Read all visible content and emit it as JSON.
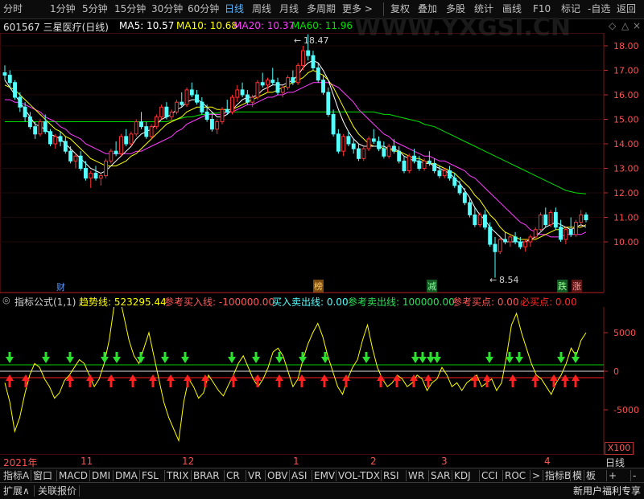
{
  "toolbar": {
    "periods": [
      "分时",
      "1分钟",
      "5分钟",
      "15分钟",
      "30分钟",
      "60分钟",
      "日线",
      "周线",
      "月线",
      "多周期",
      "更多 >"
    ],
    "active_period": "日线",
    "actions": [
      "复权",
      "叠加",
      "多股",
      "统计",
      "画线",
      "F10",
      "标记",
      "-自选",
      "返回"
    ]
  },
  "title": {
    "code_name": "601567 三星医疗(日线)",
    "ma5": "MA5: 10.57",
    "ma10": "MA10: 10.68",
    "ma20": "MA20: 10.37",
    "ma60": "MA60: 11.96",
    "watermark": "WWW.YXGSI.CN"
  },
  "colors": {
    "ma5": "#ffffff",
    "ma10": "#ffff00",
    "ma20": "#ff3cff",
    "ma60": "#00e000",
    "up": "#ff3232",
    "down": "#54ffff",
    "indicator": "#ffff00"
  },
  "price_axis": {
    "ticks": [
      "18.00",
      "17.00",
      "16.00",
      "15.00",
      "14.00",
      "13.00",
      "12.00",
      "11.00",
      "10.00"
    ],
    "ylim": [
      9.6,
      18.6
    ]
  },
  "annotations": {
    "high": "18.47",
    "low": "8.54",
    "markers": [
      {
        "label": "财",
        "color": "#5a9aff"
      },
      {
        "label": "榜",
        "color": "#e89a2c"
      },
      {
        "label": "减",
        "color": "#2cd05a"
      },
      {
        "label": "跌",
        "color": "#2cd05a"
      },
      {
        "label": "涨",
        "color": "#ff3c3c"
      }
    ]
  },
  "indicator": {
    "header_prefix": "指标公式(1,1)",
    "trend": "趋势线: 523295.44",
    "ref_buy_line": "参考买入线: -100000.00",
    "buy_sell_line": "买入卖出线: 0.00",
    "ref_sell_line": "参考卖出线: 100000.00",
    "ref_buy_point": "参考买点: 0.00",
    "must_buy": "必买点: 0.00",
    "ticks": [
      "5000",
      "0",
      "-5000"
    ],
    "scale_label": "X100"
  },
  "chart_data": {
    "type": "candlestick",
    "ylim": [
      9.6,
      18.6
    ],
    "candles": [
      [
        16.9,
        17.2,
        16.6,
        16.8
      ],
      [
        16.8,
        17.0,
        16.3,
        16.5
      ],
      [
        16.5,
        16.6,
        15.8,
        15.9
      ],
      [
        15.9,
        16.1,
        15.3,
        15.5
      ],
      [
        15.5,
        15.7,
        14.9,
        15.1
      ],
      [
        15.1,
        15.3,
        14.6,
        14.7
      ],
      [
        14.7,
        14.9,
        14.2,
        14.4
      ],
      [
        14.4,
        15.0,
        14.3,
        14.9
      ],
      [
        14.9,
        15.2,
        14.4,
        14.5
      ],
      [
        14.5,
        14.6,
        13.9,
        14.0
      ],
      [
        14.0,
        14.4,
        13.8,
        14.3
      ],
      [
        14.3,
        14.5,
        13.9,
        14.1
      ],
      [
        14.1,
        14.3,
        13.6,
        13.7
      ],
      [
        13.7,
        13.9,
        13.2,
        13.3
      ],
      [
        13.3,
        13.6,
        13.0,
        13.5
      ],
      [
        13.5,
        13.7,
        12.9,
        13.0
      ],
      [
        13.0,
        13.3,
        12.5,
        12.6
      ],
      [
        12.6,
        12.9,
        12.2,
        12.8
      ],
      [
        12.8,
        13.1,
        12.5,
        12.6
      ],
      [
        12.6,
        12.8,
        12.3,
        12.7
      ],
      [
        12.7,
        13.4,
        12.6,
        13.3
      ],
      [
        13.3,
        13.8,
        13.2,
        13.7
      ],
      [
        13.7,
        14.1,
        13.5,
        13.6
      ],
      [
        13.6,
        14.4,
        13.5,
        14.3
      ],
      [
        14.3,
        14.6,
        13.9,
        14.0
      ],
      [
        14.0,
        14.5,
        13.9,
        14.4
      ],
      [
        14.4,
        15.0,
        14.3,
        14.9
      ],
      [
        14.9,
        15.3,
        14.6,
        14.7
      ],
      [
        14.7,
        14.9,
        14.2,
        14.3
      ],
      [
        14.3,
        14.8,
        14.2,
        14.7
      ],
      [
        14.7,
        15.2,
        14.6,
        15.1
      ],
      [
        15.1,
        15.6,
        15.0,
        15.5
      ],
      [
        15.5,
        15.7,
        15.0,
        15.1
      ],
      [
        15.1,
        15.4,
        14.9,
        15.3
      ],
      [
        15.3,
        15.8,
        15.2,
        15.7
      ],
      [
        15.7,
        16.1,
        15.5,
        15.6
      ],
      [
        15.6,
        16.3,
        15.5,
        16.2
      ],
      [
        16.2,
        16.5,
        15.9,
        16.0
      ],
      [
        16.0,
        16.2,
        15.6,
        15.7
      ],
      [
        15.7,
        15.9,
        15.2,
        15.3
      ],
      [
        15.3,
        15.6,
        14.9,
        15.0
      ],
      [
        15.0,
        15.3,
        14.5,
        14.6
      ],
      [
        14.6,
        15.0,
        14.4,
        14.9
      ],
      [
        14.9,
        15.5,
        14.8,
        15.4
      ],
      [
        15.4,
        15.8,
        15.2,
        15.3
      ],
      [
        15.3,
        16.0,
        15.2,
        15.9
      ],
      [
        15.9,
        16.4,
        15.7,
        16.2
      ],
      [
        16.2,
        16.5,
        15.9,
        16.0
      ],
      [
        16.0,
        16.2,
        15.6,
        15.7
      ],
      [
        15.7,
        16.0,
        15.5,
        15.9
      ],
      [
        15.9,
        16.6,
        15.8,
        16.5
      ],
      [
        16.5,
        16.9,
        16.3,
        16.4
      ],
      [
        16.4,
        16.7,
        16.1,
        16.6
      ],
      [
        16.6,
        17.1,
        16.4,
        16.5
      ],
      [
        16.5,
        16.7,
        16.0,
        16.1
      ],
      [
        16.1,
        16.4,
        15.9,
        16.3
      ],
      [
        16.3,
        16.8,
        16.2,
        16.7
      ],
      [
        16.7,
        17.0,
        16.4,
        16.5
      ],
      [
        16.5,
        17.3,
        16.4,
        17.2
      ],
      [
        17.2,
        18.0,
        17.0,
        17.8
      ],
      [
        17.8,
        18.47,
        17.4,
        17.6
      ],
      [
        17.6,
        17.8,
        17.0,
        17.1
      ],
      [
        17.1,
        17.3,
        16.5,
        16.6
      ],
      [
        16.6,
        16.8,
        16.0,
        16.1
      ],
      [
        16.1,
        16.3,
        15.1,
        15.2
      ],
      [
        15.2,
        15.4,
        14.3,
        14.4
      ],
      [
        14.4,
        14.6,
        13.6,
        13.7
      ],
      [
        13.7,
        14.4,
        13.5,
        14.3
      ],
      [
        14.3,
        14.5,
        13.9,
        14.0
      ],
      [
        14.0,
        14.2,
        13.6,
        13.8
      ],
      [
        13.8,
        14.0,
        13.3,
        13.4
      ],
      [
        13.4,
        13.9,
        13.3,
        13.8
      ],
      [
        13.8,
        14.3,
        13.7,
        14.2
      ],
      [
        14.2,
        14.6,
        14.0,
        14.1
      ],
      [
        14.1,
        14.3,
        13.7,
        13.8
      ],
      [
        13.8,
        14.1,
        13.4,
        13.5
      ],
      [
        13.5,
        14.0,
        13.4,
        13.9
      ],
      [
        13.9,
        14.2,
        13.6,
        13.7
      ],
      [
        13.7,
        13.9,
        13.2,
        13.3
      ],
      [
        13.3,
        13.5,
        12.8,
        12.9
      ],
      [
        12.9,
        13.6,
        12.8,
        13.5
      ],
      [
        13.5,
        13.8,
        13.2,
        13.3
      ],
      [
        13.3,
        13.5,
        12.9,
        13.0
      ],
      [
        13.0,
        13.4,
        12.9,
        13.3
      ],
      [
        13.3,
        13.7,
        13.1,
        13.2
      ],
      [
        13.2,
        13.4,
        12.8,
        12.9
      ],
      [
        12.9,
        13.1,
        12.6,
        12.7
      ],
      [
        12.7,
        13.0,
        12.6,
        12.9
      ],
      [
        12.9,
        13.1,
        12.5,
        12.6
      ],
      [
        12.6,
        12.8,
        12.2,
        12.3
      ],
      [
        12.3,
        12.5,
        11.9,
        12.0
      ],
      [
        12.0,
        12.2,
        11.5,
        11.6
      ],
      [
        11.6,
        11.8,
        11.0,
        11.1
      ],
      [
        11.1,
        11.4,
        10.6,
        10.7
      ],
      [
        10.7,
        11.2,
        10.6,
        11.1
      ],
      [
        11.1,
        11.3,
        10.5,
        10.6
      ],
      [
        10.6,
        10.8,
        9.8,
        9.9
      ],
      [
        9.9,
        10.2,
        8.54,
        9.6
      ],
      [
        9.6,
        10.2,
        9.5,
        10.1
      ],
      [
        10.1,
        10.4,
        9.9,
        10.0
      ],
      [
        10.0,
        10.3,
        9.8,
        10.2
      ],
      [
        10.2,
        10.4,
        9.9,
        10.0
      ],
      [
        10.0,
        10.2,
        9.7,
        9.8
      ],
      [
        9.8,
        10.1,
        9.6,
        10.0
      ],
      [
        10.0,
        10.3,
        9.8,
        10.2
      ],
      [
        10.2,
        10.6,
        10.1,
        10.5
      ],
      [
        10.5,
        11.2,
        10.4,
        11.1
      ],
      [
        11.1,
        11.4,
        10.6,
        10.7
      ],
      [
        10.7,
        11.3,
        10.6,
        11.2
      ],
      [
        11.2,
        11.4,
        10.5,
        10.6
      ],
      [
        10.6,
        10.9,
        10.0,
        10.1
      ],
      [
        10.1,
        10.6,
        9.9,
        10.5
      ],
      [
        10.5,
        11.0,
        10.2,
        10.3
      ],
      [
        10.3,
        10.9,
        10.2,
        10.8
      ],
      [
        10.8,
        11.3,
        10.6,
        11.1
      ],
      [
        11.1,
        11.2,
        10.8,
        10.9
      ]
    ],
    "ma_lines": {
      "ma5": [
        16.6,
        16.3,
        16.0,
        15.7,
        15.4,
        15.1,
        14.8,
        14.7,
        14.6,
        14.4,
        14.3,
        14.2,
        14.0,
        13.8,
        13.6,
        13.4,
        13.2,
        13.0,
        12.9,
        12.8,
        12.9,
        13.1,
        13.3,
        13.5,
        13.7,
        13.9,
        14.2,
        14.4,
        14.5,
        14.6,
        14.8,
        15.0,
        15.1,
        15.2,
        15.4,
        15.5,
        15.7,
        15.8,
        15.8,
        15.7,
        15.5,
        15.3,
        15.1,
        15.1,
        15.2,
        15.4,
        15.6,
        15.8,
        15.9,
        15.9,
        16.0,
        16.2,
        16.3,
        16.4,
        16.4,
        16.4,
        16.5,
        16.6,
        16.8,
        17.1,
        17.3,
        17.4,
        17.3,
        17.0,
        16.6,
        16.0,
        15.4,
        14.9,
        14.5,
        14.2,
        14.0,
        13.9,
        13.9,
        13.9,
        13.9,
        13.9,
        13.8,
        13.8,
        13.7,
        13.5,
        13.4,
        13.3,
        13.3,
        13.2,
        13.2,
        13.1,
        13.0,
        12.9,
        12.8,
        12.6,
        12.4,
        12.1,
        11.8,
        11.4,
        11.1,
        10.9,
        10.6,
        10.4,
        10.2,
        10.0,
        10.0,
        10.0,
        10.0,
        10.0,
        10.1,
        10.2,
        10.4,
        10.6,
        10.7,
        10.8,
        10.7,
        10.6,
        10.5,
        10.6,
        10.7,
        10.6
      ],
      "ma10": [
        16.4,
        16.3,
        16.2,
        16.0,
        15.8,
        15.6,
        15.4,
        15.2,
        15.0,
        14.8,
        14.6,
        14.5,
        14.3,
        14.2,
        14.0,
        13.8,
        13.6,
        13.4,
        13.3,
        13.2,
        13.1,
        13.1,
        13.1,
        13.2,
        13.3,
        13.5,
        13.6,
        13.8,
        14.0,
        14.2,
        14.4,
        14.6,
        14.8,
        14.9,
        15.0,
        15.1,
        15.3,
        15.4,
        15.5,
        15.5,
        15.5,
        15.5,
        15.4,
        15.4,
        15.4,
        15.4,
        15.5,
        15.6,
        15.7,
        15.8,
        15.9,
        16.0,
        16.1,
        16.1,
        16.2,
        16.3,
        16.4,
        16.5,
        16.6,
        16.7,
        16.9,
        17.0,
        16.9,
        16.8,
        16.6,
        16.3,
        15.9,
        15.5,
        15.1,
        14.7,
        14.4,
        14.2,
        14.0,
        13.9,
        13.9,
        13.8,
        13.8,
        13.7,
        13.7,
        13.6,
        13.5,
        13.4,
        13.4,
        13.3,
        13.2,
        13.2,
        13.1,
        13.0,
        12.9,
        12.8,
        12.6,
        12.4,
        12.2,
        11.9,
        11.7,
        11.4,
        11.1,
        10.9,
        10.6,
        10.4,
        10.3,
        10.2,
        10.1,
        10.1,
        10.1,
        10.1,
        10.2,
        10.3,
        10.4,
        10.5,
        10.5,
        10.6,
        10.6,
        10.6,
        10.6,
        10.7
      ],
      "ma20": [
        15.8,
        15.8,
        15.7,
        15.7,
        15.6,
        15.5,
        15.4,
        15.3,
        15.1,
        15.0,
        14.9,
        14.7,
        14.6,
        14.4,
        14.3,
        14.2,
        14.0,
        13.9,
        13.8,
        13.7,
        13.6,
        13.6,
        13.6,
        13.6,
        13.6,
        13.6,
        13.7,
        13.7,
        13.8,
        13.9,
        14.0,
        14.1,
        14.2,
        14.3,
        14.5,
        14.6,
        14.8,
        14.9,
        15.0,
        15.1,
        15.2,
        15.2,
        15.2,
        15.2,
        15.3,
        15.3,
        15.4,
        15.5,
        15.6,
        15.6,
        15.7,
        15.8,
        15.9,
        15.9,
        16.0,
        16.0,
        16.1,
        16.1,
        16.2,
        16.3,
        16.4,
        16.5,
        16.5,
        16.5,
        16.5,
        16.4,
        16.3,
        16.1,
        15.9,
        15.7,
        15.4,
        15.2,
        15.0,
        14.8,
        14.6,
        14.4,
        14.3,
        14.1,
        14.0,
        13.9,
        13.8,
        13.7,
        13.6,
        13.5,
        13.5,
        13.4,
        13.3,
        13.3,
        13.2,
        13.1,
        13.0,
        12.9,
        12.7,
        12.6,
        12.4,
        12.2,
        12.0,
        11.8,
        11.6,
        11.4,
        11.2,
        11.0,
        10.8,
        10.7,
        10.5,
        10.4,
        10.3,
        10.3,
        10.2,
        10.2,
        10.2,
        10.3,
        10.3,
        10.3,
        10.3,
        10.4
      ],
      "ma60": [
        14.9,
        14.9,
        14.9,
        14.9,
        14.9,
        14.9,
        14.9,
        14.9,
        14.9,
        14.9,
        14.9,
        14.9,
        14.9,
        14.9,
        14.9,
        14.9,
        14.9,
        14.9,
        14.9,
        14.9,
        14.9,
        14.9,
        14.9,
        14.9,
        14.9,
        14.9,
        14.9,
        14.9,
        14.9,
        14.9,
        14.9,
        14.9,
        14.9,
        14.95,
        15.0,
        15.05,
        15.1,
        15.1,
        15.15,
        15.2,
        15.2,
        15.25,
        15.25,
        15.3,
        15.3,
        15.3,
        15.3,
        15.3,
        15.3,
        15.3,
        15.3,
        15.3,
        15.3,
        15.3,
        15.3,
        15.3,
        15.3,
        15.3,
        15.3,
        15.3,
        15.3,
        15.3,
        15.3,
        15.3,
        15.3,
        15.3,
        15.3,
        15.3,
        15.3,
        15.3,
        15.3,
        15.3,
        15.3,
        15.3,
        15.25,
        15.2,
        15.2,
        15.15,
        15.1,
        15.05,
        15.0,
        14.95,
        14.9,
        14.8,
        14.75,
        14.7,
        14.6,
        14.5,
        14.4,
        14.3,
        14.2,
        14.1,
        14.0,
        13.9,
        13.8,
        13.7,
        13.6,
        13.5,
        13.4,
        13.3,
        13.2,
        13.1,
        13.0,
        12.9,
        12.8,
        12.7,
        12.6,
        12.5,
        12.4,
        12.3,
        12.2,
        12.1,
        12.05,
        12.0,
        11.98,
        11.96
      ]
    },
    "indicator_line": [
      -15,
      -40,
      -78,
      -60,
      -30,
      -5,
      10,
      5,
      -10,
      -20,
      -35,
      -28,
      -12,
      -5,
      5,
      15,
      10,
      -5,
      -20,
      -10,
      10,
      40,
      85,
      100,
      70,
      40,
      20,
      10,
      30,
      50,
      20,
      -10,
      -40,
      -60,
      -75,
      -90,
      -40,
      -10,
      -20,
      -35,
      -28,
      -5,
      -15,
      -25,
      -32,
      -18,
      -5,
      10,
      20,
      5,
      -10,
      -20,
      -10,
      5,
      25,
      30,
      20,
      0,
      -20,
      -10,
      15,
      35,
      50,
      62,
      45,
      20,
      0,
      -20,
      -30,
      -10,
      5,
      15,
      40,
      60,
      30,
      5,
      -10,
      -20,
      -15,
      -5,
      -10,
      -20,
      -15,
      -5,
      -10,
      -25,
      -15,
      -10,
      5,
      -5,
      -20,
      -15,
      -25,
      -15,
      -10,
      -5,
      -20,
      -15,
      -10,
      -25,
      -15,
      20,
      60,
      75,
      50,
      30,
      10,
      -5,
      -10,
      -20,
      -30,
      -15,
      -5,
      10,
      30,
      20,
      40,
      50
    ],
    "xlabels": [
      "2021年",
      "11",
      "12",
      "1",
      "2",
      "3",
      "4"
    ]
  },
  "bottom_tabs": [
    "指标A",
    "窗口",
    "MACD",
    "DMI",
    "DMA",
    "FSL",
    "TRIX",
    "BRAR",
    "CR",
    "VR",
    "OBV",
    "ASI",
    "EMV",
    "VOL-TDX",
    "RSI",
    "WR",
    "SAR",
    "KDJ",
    "CCI",
    "ROC",
    ">",
    "指标B",
    "模",
    "板",
    "+",
    "-"
  ],
  "status": {
    "expand": "扩展∧",
    "related": "关联报价",
    "promo": "新用户福利专享",
    "period_label": "日线"
  }
}
